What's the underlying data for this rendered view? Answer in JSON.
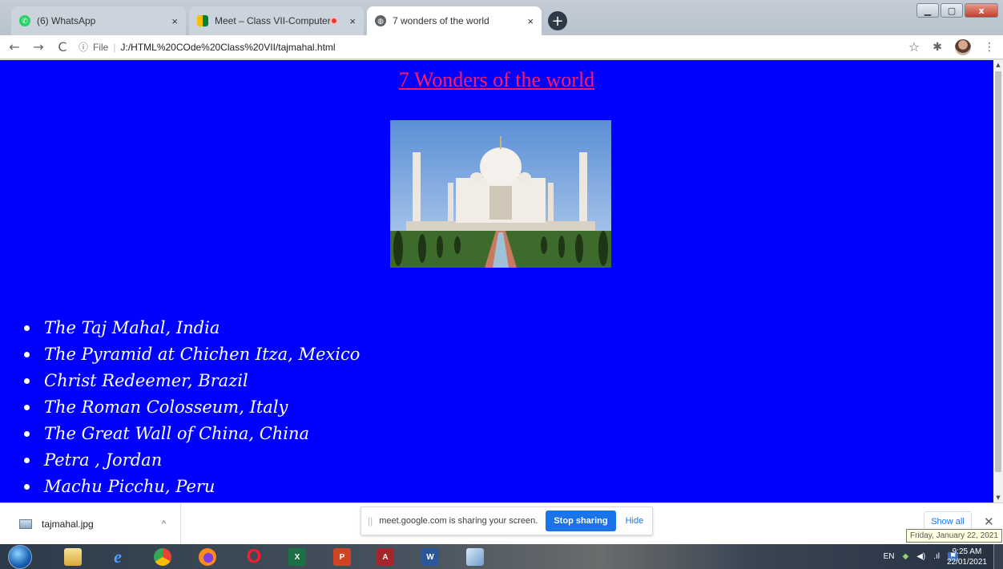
{
  "browser": {
    "tabs": [
      {
        "title": "(6) WhatsApp",
        "icon": "whatsapp-icon",
        "color": "#25d366"
      },
      {
        "title": "Meet – Class VII-Computer",
        "icon": "google-meet-icon",
        "color": "#00832d"
      },
      {
        "title": "7 wonders of the world",
        "icon": "globe-icon",
        "color": "#5f6368"
      }
    ],
    "close_glyph": "×",
    "new_tab_glyph": "+",
    "address": {
      "scheme_label": "File",
      "url": "J:/HTML%20COde%20Class%20VII/tajmahal.html"
    }
  },
  "page": {
    "background": "#0000ff",
    "heading": "7 Wonders of the world",
    "heading_color": "#ff1a66",
    "image_subject": "Taj Mahal photo",
    "wonders": [
      "The Taj Mahal, India",
      "The Pyramid at Chichen Itza, Mexico",
      "Christ Redeemer, Brazil",
      "The Roman Colosseum, Italy",
      "The Great Wall of China, China",
      "Petra , Jordan",
      "Machu Picchu, Peru"
    ]
  },
  "downloads": {
    "file_name": "tajmahal.jpg",
    "show_all_label": "Show all",
    "close_glyph": "✕"
  },
  "screen_share": {
    "message": "meet.google.com is sharing your screen.",
    "stop_label": "Stop sharing",
    "hide_label": "Hide",
    "accent": "#1a73e8"
  },
  "tooltip": "Friday, January 22, 2021",
  "taskbar": {
    "apps": [
      {
        "name": "explorer",
        "icon": "folder-icon",
        "label": ""
      },
      {
        "name": "internet-explorer",
        "icon": "ie-icon",
        "label": "e"
      },
      {
        "name": "chrome",
        "icon": "chrome-icon",
        "label": ""
      },
      {
        "name": "firefox",
        "icon": "firefox-icon",
        "label": ""
      },
      {
        "name": "opera",
        "icon": "opera-icon",
        "label": "O"
      },
      {
        "name": "excel",
        "icon": "excel-icon",
        "label": "X"
      },
      {
        "name": "powerpoint",
        "icon": "powerpoint-icon",
        "label": "P"
      },
      {
        "name": "access",
        "icon": "access-icon",
        "label": "A"
      },
      {
        "name": "word",
        "icon": "word-icon",
        "label": "W"
      },
      {
        "name": "paint",
        "icon": "paint-icon",
        "label": ""
      }
    ],
    "language": "EN",
    "time": "9:25 AM",
    "date": "22/01/2021"
  }
}
